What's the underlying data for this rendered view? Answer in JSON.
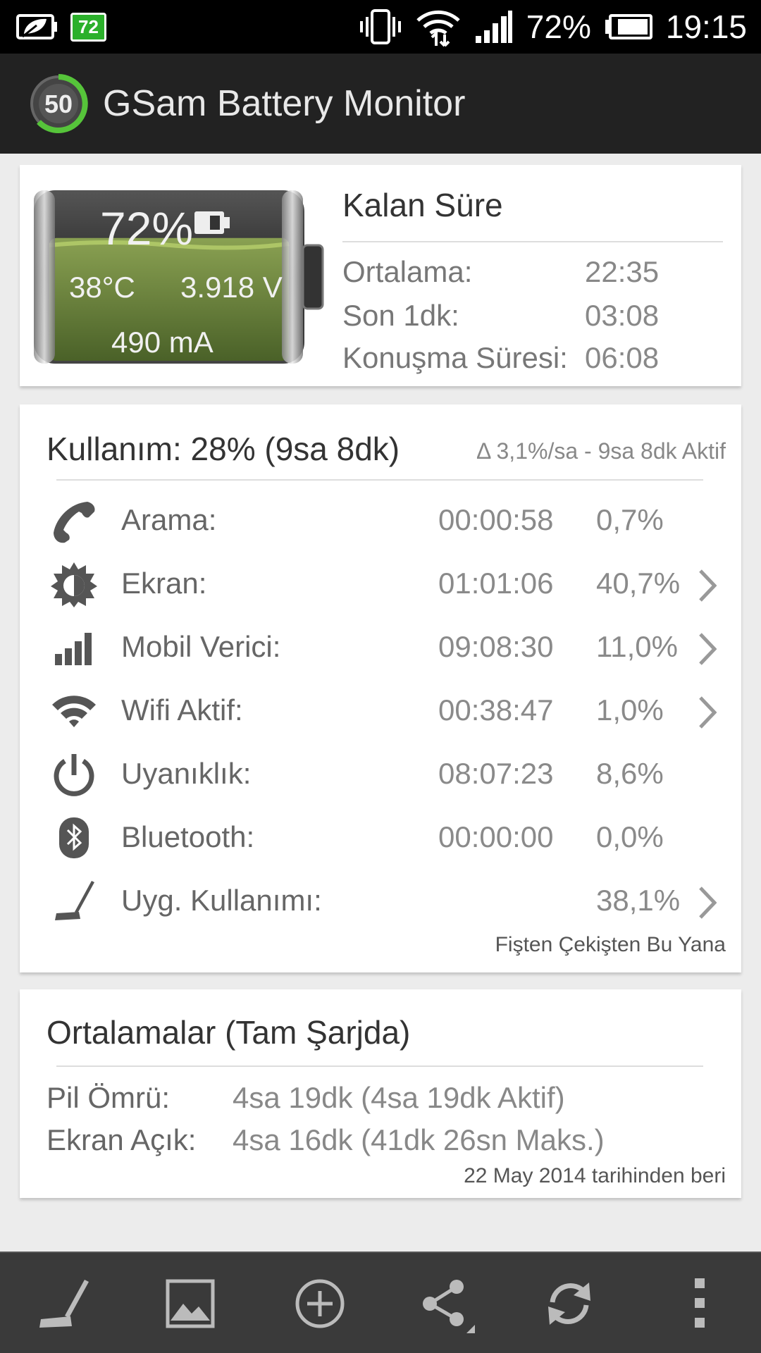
{
  "status_bar": {
    "battery_badge": "72",
    "battery_percent": "72%",
    "time": "19:15",
    "icons": [
      "leaf-battery-icon",
      "vibrate-icon",
      "wifi-icon",
      "signal-icon",
      "battery-icon"
    ]
  },
  "app_bar": {
    "logo_value": "50",
    "title": "GSam Battery Monitor"
  },
  "battery": {
    "percent": "72%",
    "level": 0.72,
    "temperature": "38°C",
    "voltage": "3.918 V",
    "current": "490 mA"
  },
  "remaining": {
    "title": "Kalan Süre",
    "rows": [
      {
        "label": "Ortalama:",
        "value": "22:35"
      },
      {
        "label": "Son 1dk:",
        "value": "03:08"
      },
      {
        "label": "Konuşma Süresi:",
        "value": "06:08"
      }
    ]
  },
  "usage": {
    "title": "Kullanım: 28% (9sa 8dk)",
    "subtitle": "Δ 3,1%/sa - 9sa 8dk Aktif",
    "rows": [
      {
        "icon": "phone-icon",
        "label": "Arama:",
        "time": "00:00:58",
        "percent": "0,7%",
        "chevron": false
      },
      {
        "icon": "screen-brightness-icon",
        "label": "Ekran:",
        "time": "01:01:06",
        "percent": "40,7%",
        "chevron": true
      },
      {
        "icon": "cell-signal-icon",
        "label": "Mobil Verici:",
        "time": "09:08:30",
        "percent": "11,0%",
        "chevron": true
      },
      {
        "icon": "wifi-icon",
        "label": "Wifi Aktif:",
        "time": "00:38:47",
        "percent": "1,0%",
        "chevron": true
      },
      {
        "icon": "power-icon",
        "label": "Uyanıklık:",
        "time": "08:07:23",
        "percent": "8,6%",
        "chevron": false
      },
      {
        "icon": "bluetooth-icon",
        "label": "Bluetooth:",
        "time": "00:00:00",
        "percent": "0,0%",
        "chevron": false
      },
      {
        "icon": "app-usage-icon",
        "label": "Uyg. Kullanımı:",
        "time": "",
        "percent": "38,1%",
        "chevron": true
      }
    ],
    "footer": "Fişten Çekişten Bu Yana"
  },
  "averages": {
    "title": "Ortalamalar (Tam Şarjda)",
    "rows": [
      {
        "label": "Pil Ömrü:",
        "value": "4sa 19dk (4sa 19dk Aktif)"
      },
      {
        "label": "Ekran Açık:",
        "value": "4sa 16dk (41dk 26sn Maks.)"
      }
    ],
    "footer": "22 May 2014 tarihinden beri"
  },
  "bottom_bar": {
    "buttons": [
      "app-usage-icon",
      "image-icon",
      "add-icon",
      "share-icon",
      "refresh-icon",
      "overflow-menu-icon"
    ]
  }
}
